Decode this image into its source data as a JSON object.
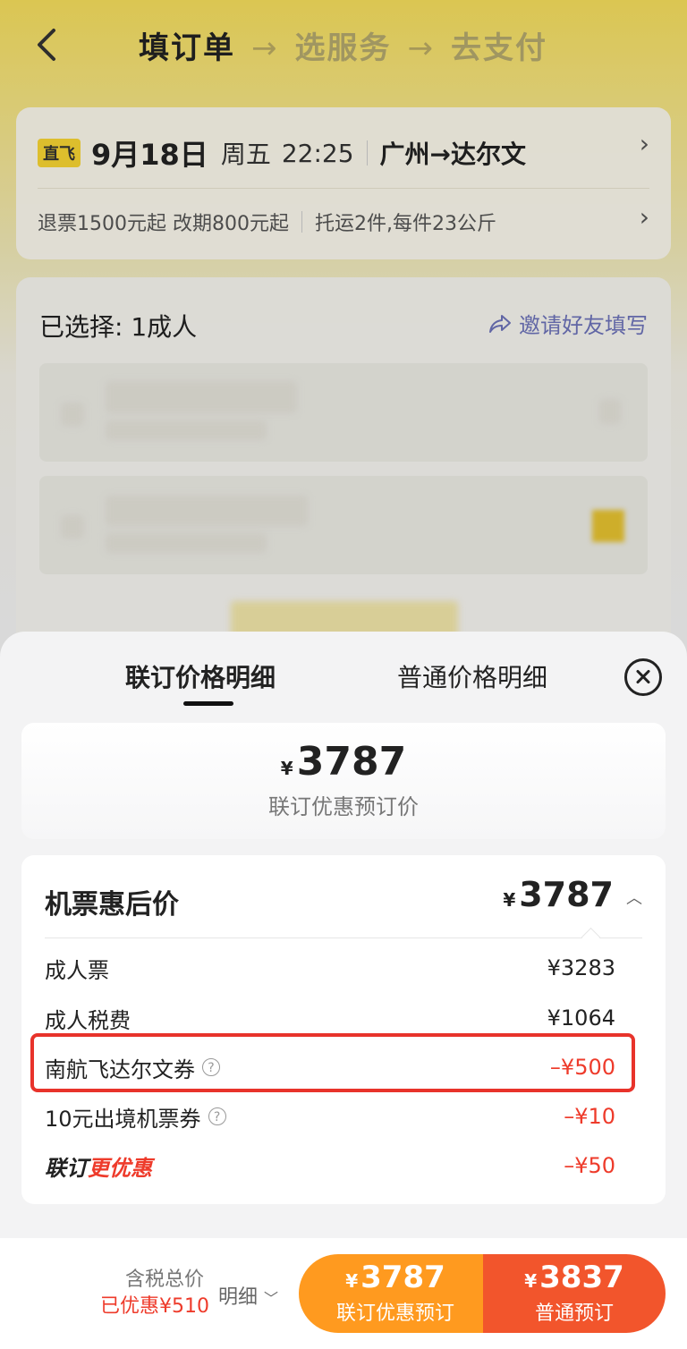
{
  "header": {
    "steps": [
      "填订单",
      "选服务",
      "去支付"
    ],
    "separator": "→"
  },
  "flight": {
    "badge": "直飞",
    "date": "9月18日",
    "weekday": "周五",
    "time": "22:25",
    "route": "广州→达尔文",
    "policy": "退票1500元起 改期800元起",
    "baggage": "托运2件,每件23公斤"
  },
  "passengers": {
    "selected_label": "已选择: 1成人",
    "invite_label": "邀请好友填写"
  },
  "sheet": {
    "tabs": [
      "联订价格明细",
      "普通价格明细"
    ],
    "summary": {
      "currency": "¥",
      "price": "3787",
      "label": "联订优惠预订价"
    },
    "detail": {
      "title": "机票惠后价",
      "currency": "¥",
      "total": "3787",
      "rows": [
        {
          "label": "成人票",
          "value": "¥3283",
          "discount": false,
          "help": false
        },
        {
          "label": "成人税费",
          "value": "¥1064",
          "discount": false,
          "help": false
        },
        {
          "label": "南航飞达尔文券",
          "value": "–¥500",
          "discount": true,
          "help": true,
          "highlighted": true
        },
        {
          "label": "10元出境机票券",
          "value": "–¥10",
          "discount": true,
          "help": true
        },
        {
          "label_a": "联订",
          "label_b": "更优惠",
          "value": "–¥50",
          "discount": true,
          "help": false
        }
      ]
    }
  },
  "footer": {
    "total_label": "含税总价",
    "saved_label": "已优惠¥510",
    "details_label": "明细",
    "btn_combo": {
      "currency": "¥",
      "price": "3787",
      "label": "联订优惠预订"
    },
    "btn_normal": {
      "currency": "¥",
      "price": "3837",
      "label": "普通预订"
    }
  },
  "colors": {
    "accent_yellow": "#f4dd5c",
    "orange": "#ff9a1f",
    "red": "#f2552c",
    "discount_red": "#ee3b2b"
  }
}
